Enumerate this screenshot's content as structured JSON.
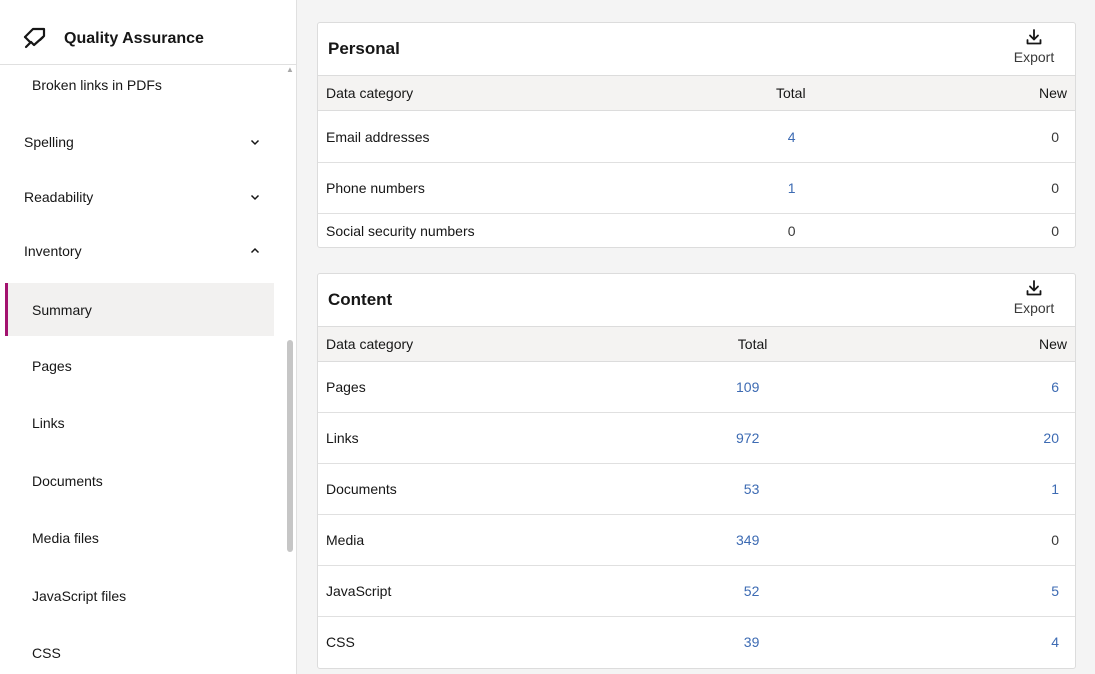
{
  "sidebar": {
    "title": "Quality Assurance",
    "items": [
      {
        "label": "Broken links in PDFs"
      },
      {
        "label": "Spelling"
      },
      {
        "label": "Readability"
      },
      {
        "label": "Inventory"
      },
      {
        "label": "Summary"
      },
      {
        "label": "Pages"
      },
      {
        "label": "Links"
      },
      {
        "label": "Documents"
      },
      {
        "label": "Media files"
      },
      {
        "label": "JavaScript files"
      },
      {
        "label": "CSS"
      }
    ]
  },
  "personal": {
    "title": "Personal",
    "export_label": "Export",
    "headers": [
      "Data category",
      "Total",
      "New"
    ],
    "rows": [
      {
        "category": "Email addresses",
        "total": "4",
        "new": "0"
      },
      {
        "category": "Phone numbers",
        "total": "1",
        "new": "0"
      },
      {
        "category": "Social security numbers",
        "total": "0",
        "new": "0"
      }
    ]
  },
  "content": {
    "title": "Content",
    "export_label": "Export",
    "headers": [
      "Data category",
      "Total",
      "New"
    ],
    "rows": [
      {
        "category": "Pages",
        "total": "109",
        "new": "6"
      },
      {
        "category": "Links",
        "total": "972",
        "new": "20"
      },
      {
        "category": "Documents",
        "total": "53",
        "new": "1"
      },
      {
        "category": "Media",
        "total": "349",
        "new": "0"
      },
      {
        "category": "JavaScript",
        "total": "52",
        "new": "5"
      },
      {
        "category": "CSS",
        "total": "39",
        "new": "4"
      }
    ]
  },
  "colors": {
    "accent": "#a3126f",
    "link": "#3d6bb3"
  }
}
